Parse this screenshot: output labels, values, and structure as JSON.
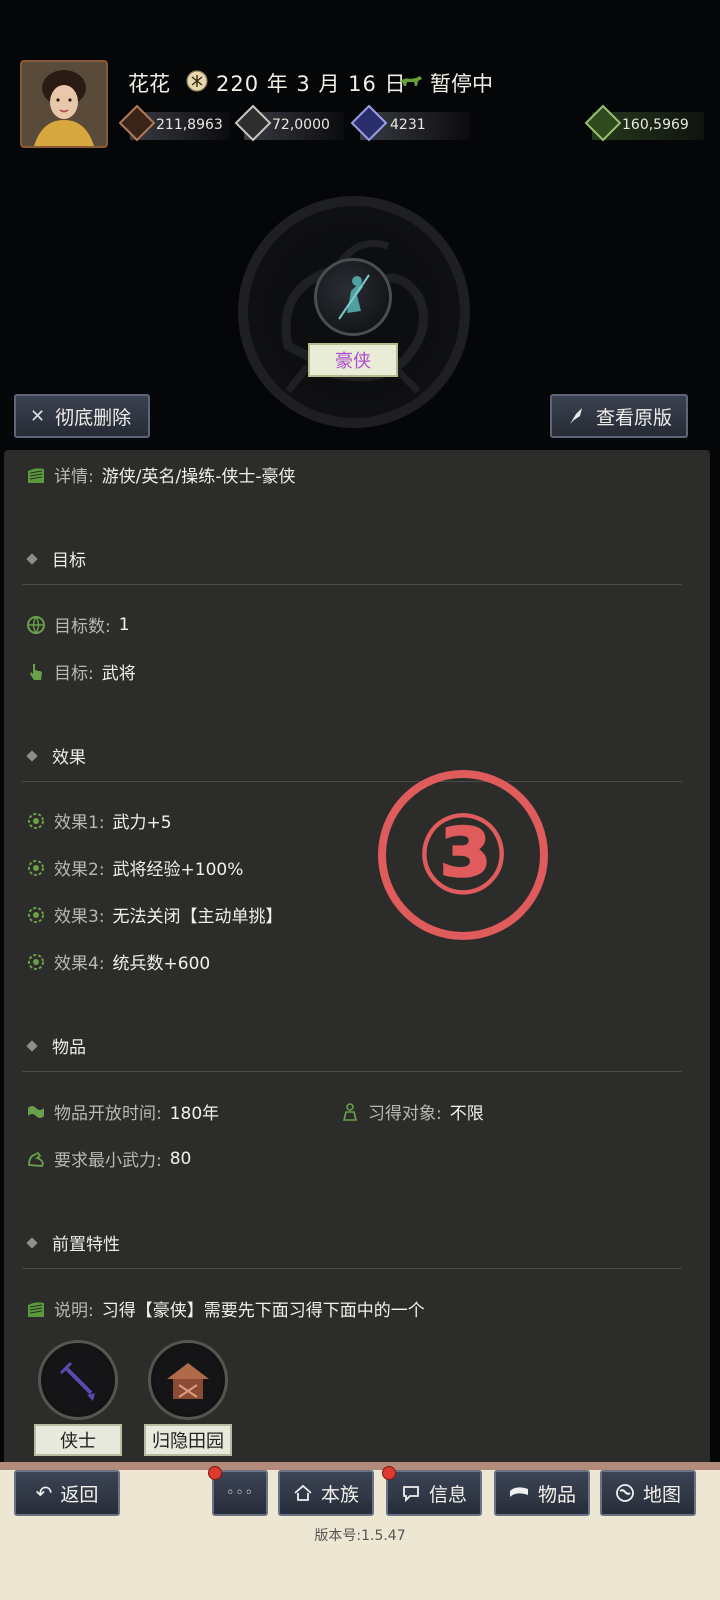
{
  "header": {
    "player_name": "花花",
    "date": "220 年 3 月 16 日",
    "status": "暂停中",
    "resources": [
      "211,8963",
      "72,0000",
      "4231",
      "160,5969"
    ]
  },
  "trait": {
    "name": "豪侠",
    "actions": {
      "delete": "彻底删除",
      "view_original": "查看原版"
    }
  },
  "details": {
    "detail_label": "详情:",
    "detail_value": "游侠/英名/操练-侠士-豪侠",
    "target_section": "目标",
    "target_count_label": "目标数:",
    "target_count_value": "1",
    "target_label": "目标:",
    "target_value": "武将",
    "effect_section": "效果",
    "effects": [
      {
        "label": "效果1:",
        "value": "武力+5"
      },
      {
        "label": "效果2:",
        "value": "武将经验+100%"
      },
      {
        "label": "效果3:",
        "value": "无法关闭【主动单挑】"
      },
      {
        "label": "效果4:",
        "value": "统兵数+600"
      }
    ],
    "item_section": "物品",
    "open_time_label": "物品开放时间:",
    "open_time_value": "180年",
    "learn_target_label": "习得对象:",
    "learn_target_value": "不限",
    "min_force_label": "要求最小武力:",
    "min_force_value": "80",
    "prereq_section": "前置特性",
    "note_label": "说明:",
    "note_value": "习得【豪侠】需要先下面习得下面中的一个",
    "prereqs": [
      "侠士",
      "归隐田园"
    ]
  },
  "annotation": "③",
  "bottom_nav": {
    "back": "返回",
    "more": "◦◦◦",
    "clan": "本族",
    "info": "信息",
    "items": "物品",
    "map": "地图"
  },
  "version": "版本号:1.5.47"
}
